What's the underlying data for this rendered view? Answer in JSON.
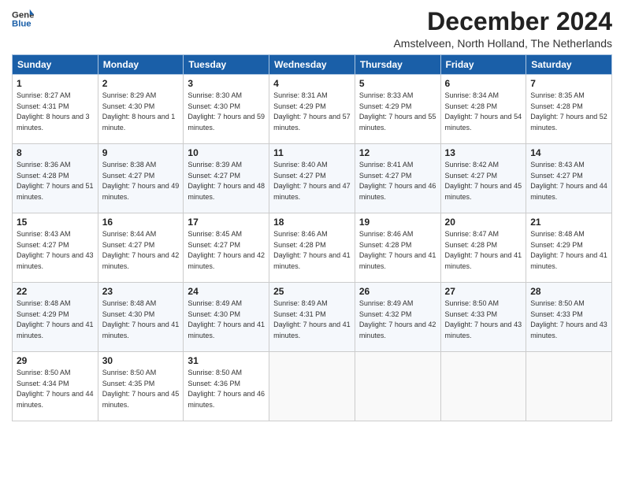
{
  "logo": {
    "line1": "General",
    "line2": "Blue"
  },
  "title": "December 2024",
  "location": "Amstelveen, North Holland, The Netherlands",
  "days_of_week": [
    "Sunday",
    "Monday",
    "Tuesday",
    "Wednesday",
    "Thursday",
    "Friday",
    "Saturday"
  ],
  "weeks": [
    [
      {
        "day": 1,
        "sunrise": "8:27 AM",
        "sunset": "4:31 PM",
        "daylight": "8 hours and 3 minutes."
      },
      {
        "day": 2,
        "sunrise": "8:29 AM",
        "sunset": "4:30 PM",
        "daylight": "8 hours and 1 minute."
      },
      {
        "day": 3,
        "sunrise": "8:30 AM",
        "sunset": "4:30 PM",
        "daylight": "7 hours and 59 minutes."
      },
      {
        "day": 4,
        "sunrise": "8:31 AM",
        "sunset": "4:29 PM",
        "daylight": "7 hours and 57 minutes."
      },
      {
        "day": 5,
        "sunrise": "8:33 AM",
        "sunset": "4:29 PM",
        "daylight": "7 hours and 55 minutes."
      },
      {
        "day": 6,
        "sunrise": "8:34 AM",
        "sunset": "4:28 PM",
        "daylight": "7 hours and 54 minutes."
      },
      {
        "day": 7,
        "sunrise": "8:35 AM",
        "sunset": "4:28 PM",
        "daylight": "7 hours and 52 minutes."
      }
    ],
    [
      {
        "day": 8,
        "sunrise": "8:36 AM",
        "sunset": "4:28 PM",
        "daylight": "7 hours and 51 minutes."
      },
      {
        "day": 9,
        "sunrise": "8:38 AM",
        "sunset": "4:27 PM",
        "daylight": "7 hours and 49 minutes."
      },
      {
        "day": 10,
        "sunrise": "8:39 AM",
        "sunset": "4:27 PM",
        "daylight": "7 hours and 48 minutes."
      },
      {
        "day": 11,
        "sunrise": "8:40 AM",
        "sunset": "4:27 PM",
        "daylight": "7 hours and 47 minutes."
      },
      {
        "day": 12,
        "sunrise": "8:41 AM",
        "sunset": "4:27 PM",
        "daylight": "7 hours and 46 minutes."
      },
      {
        "day": 13,
        "sunrise": "8:42 AM",
        "sunset": "4:27 PM",
        "daylight": "7 hours and 45 minutes."
      },
      {
        "day": 14,
        "sunrise": "8:43 AM",
        "sunset": "4:27 PM",
        "daylight": "7 hours and 44 minutes."
      }
    ],
    [
      {
        "day": 15,
        "sunrise": "8:43 AM",
        "sunset": "4:27 PM",
        "daylight": "7 hours and 43 minutes."
      },
      {
        "day": 16,
        "sunrise": "8:44 AM",
        "sunset": "4:27 PM",
        "daylight": "7 hours and 42 minutes."
      },
      {
        "day": 17,
        "sunrise": "8:45 AM",
        "sunset": "4:27 PM",
        "daylight": "7 hours and 42 minutes."
      },
      {
        "day": 18,
        "sunrise": "8:46 AM",
        "sunset": "4:28 PM",
        "daylight": "7 hours and 41 minutes."
      },
      {
        "day": 19,
        "sunrise": "8:46 AM",
        "sunset": "4:28 PM",
        "daylight": "7 hours and 41 minutes."
      },
      {
        "day": 20,
        "sunrise": "8:47 AM",
        "sunset": "4:28 PM",
        "daylight": "7 hours and 41 minutes."
      },
      {
        "day": 21,
        "sunrise": "8:48 AM",
        "sunset": "4:29 PM",
        "daylight": "7 hours and 41 minutes."
      }
    ],
    [
      {
        "day": 22,
        "sunrise": "8:48 AM",
        "sunset": "4:29 PM",
        "daylight": "7 hours and 41 minutes."
      },
      {
        "day": 23,
        "sunrise": "8:48 AM",
        "sunset": "4:30 PM",
        "daylight": "7 hours and 41 minutes."
      },
      {
        "day": 24,
        "sunrise": "8:49 AM",
        "sunset": "4:30 PM",
        "daylight": "7 hours and 41 minutes."
      },
      {
        "day": 25,
        "sunrise": "8:49 AM",
        "sunset": "4:31 PM",
        "daylight": "7 hours and 41 minutes."
      },
      {
        "day": 26,
        "sunrise": "8:49 AM",
        "sunset": "4:32 PM",
        "daylight": "7 hours and 42 minutes."
      },
      {
        "day": 27,
        "sunrise": "8:50 AM",
        "sunset": "4:33 PM",
        "daylight": "7 hours and 43 minutes."
      },
      {
        "day": 28,
        "sunrise": "8:50 AM",
        "sunset": "4:33 PM",
        "daylight": "7 hours and 43 minutes."
      }
    ],
    [
      {
        "day": 29,
        "sunrise": "8:50 AM",
        "sunset": "4:34 PM",
        "daylight": "7 hours and 44 minutes."
      },
      {
        "day": 30,
        "sunrise": "8:50 AM",
        "sunset": "4:35 PM",
        "daylight": "7 hours and 45 minutes."
      },
      {
        "day": 31,
        "sunrise": "8:50 AM",
        "sunset": "4:36 PM",
        "daylight": "7 hours and 46 minutes."
      },
      null,
      null,
      null,
      null
    ]
  ]
}
